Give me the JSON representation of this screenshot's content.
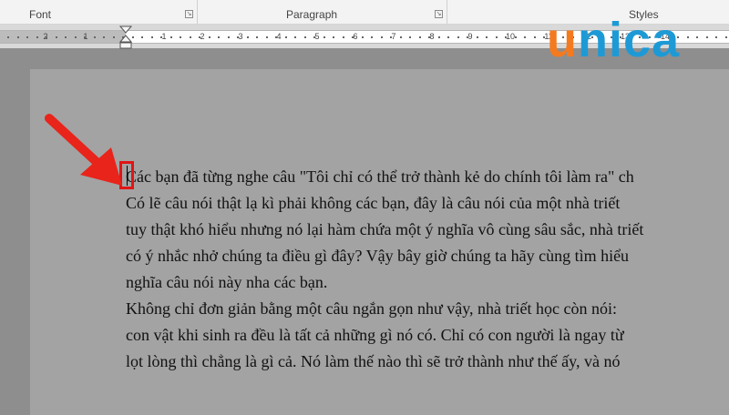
{
  "ribbon": {
    "groups": [
      {
        "label": "Font"
      },
      {
        "label": "Paragraph"
      },
      {
        "label": "Styles"
      }
    ]
  },
  "ruler": {
    "labels": [
      "2",
      "1",
      "1",
      "2",
      "3",
      "4",
      "5",
      "6",
      "7",
      "8",
      "9",
      "10",
      "11",
      "12",
      "13",
      "14"
    ]
  },
  "logo": {
    "letters": [
      "u",
      "n",
      "i",
      "c",
      "a"
    ],
    "colors": {
      "orange": "#f47a20",
      "blue": "#1d9ad6"
    }
  },
  "document": {
    "lines": [
      "Các bạn đã từng nghe câu \"Tôi chỉ có thể trở thành kẻ do chính tôi làm ra\" ch",
      "Có lẽ câu nói thật lạ kì phải không các bạn, đây là câu nói của một nhà triết",
      "tuy thật khó hiểu nhưng nó lại hàm chứa một ý nghĩa vô cùng sâu sắc, nhà triết",
      "có ý nhắc nhở chúng ta điều gì đây? Vậy bây giờ chúng ta hãy cùng tìm hiểu",
      "nghĩa câu nói này nha các bạn.",
      "Không chỉ đơn giản bằng một câu ngắn gọn như vậy, nhà triết học còn nói:",
      "con vật khi sinh ra đều là tất cả những gì nó có. Chỉ có con người là ngay từ",
      "lọt lòng thì chẳng là gì cả. Nó làm thế nào thì sẽ trở thành như thế ấy, và nó"
    ]
  },
  "annotation": {
    "arrow_color": "#e8241b",
    "box_color": "#e01515"
  }
}
